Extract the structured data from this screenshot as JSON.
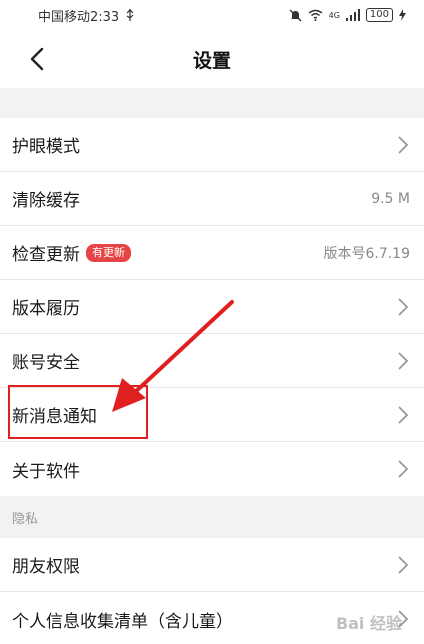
{
  "status_bar": {
    "carrier_time": "中国移动2:33",
    "usb_icon": "usb-icon",
    "network": "4G",
    "battery": "100"
  },
  "header": {
    "title": "设置",
    "back_icon": "chevron-left-icon"
  },
  "settings": [
    {
      "label": "护眼模式",
      "value": "",
      "chevron": true
    },
    {
      "label": "清除缓存",
      "value": "9.5 M",
      "chevron": false
    },
    {
      "label": "检查更新",
      "badge": "有更新",
      "value": "版本号6.7.19",
      "chevron": false
    },
    {
      "label": "版本履历",
      "value": "",
      "chevron": true
    },
    {
      "label": "账号安全",
      "value": "",
      "chevron": true
    },
    {
      "label": "新消息通知",
      "value": "",
      "chevron": true
    },
    {
      "label": "关于软件",
      "value": "",
      "chevron": true
    }
  ],
  "privacy_section": {
    "header": "隐私",
    "items": [
      {
        "label": "朋友权限",
        "chevron": true
      },
      {
        "label": "个人信息收集清单（含儿童）",
        "chevron": true
      }
    ]
  },
  "colors": {
    "badge": "#e64545",
    "annotation": "#e02020"
  }
}
